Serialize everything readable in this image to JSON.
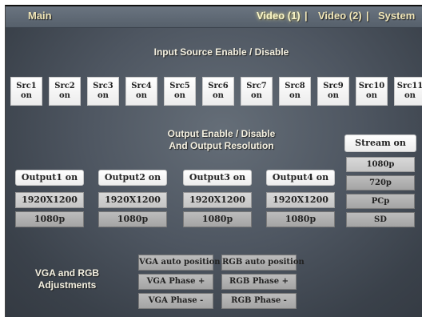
{
  "nav": {
    "main": "Main",
    "video1": "Video (1)",
    "sep1": "|",
    "video2": "Video (2)",
    "sep2": "|",
    "system": "System"
  },
  "input_section": {
    "title": "Input Source Enable / Disable",
    "sources": [
      {
        "name": "Src1",
        "state": "on"
      },
      {
        "name": "Src2",
        "state": "on"
      },
      {
        "name": "Src3",
        "state": "on"
      },
      {
        "name": "Src4",
        "state": "on"
      },
      {
        "name": "Src5",
        "state": "on"
      },
      {
        "name": "Src6",
        "state": "on"
      },
      {
        "name": "Src7",
        "state": "on"
      },
      {
        "name": "Src8",
        "state": "on"
      },
      {
        "name": "Src9",
        "state": "on"
      },
      {
        "name": "Src10",
        "state": "on"
      },
      {
        "name": "Src11",
        "state": "on"
      }
    ]
  },
  "output_section": {
    "title_line1": "Output Enable / Disable",
    "title_line2": "And Output Resolution",
    "outputs": [
      {
        "label": "Output1 on",
        "resolution": "1920X1200",
        "format": "1080p"
      },
      {
        "label": "Output2 on",
        "resolution": "1920X1200",
        "format": "1080p"
      },
      {
        "label": "Output3 on",
        "resolution": "1920X1200",
        "format": "1080p"
      },
      {
        "label": "Output4 on",
        "resolution": "1920X1200",
        "format": "1080p"
      }
    ]
  },
  "stream": {
    "label": "Stream on",
    "options": [
      "1080p",
      "720p",
      "PCp",
      "SD"
    ]
  },
  "vga_section": {
    "title_line1": "VGA and RGB",
    "title_line2": "Adjustments",
    "vga_auto": "VGA auto position",
    "rgb_auto": "RGB auto position",
    "vga_phase_plus": "VGA Phase +",
    "rgb_phase_plus": "RGB Phase +",
    "vga_phase_minus": "VGA Phase -",
    "rgb_phase_minus": "RGB Phase -"
  }
}
